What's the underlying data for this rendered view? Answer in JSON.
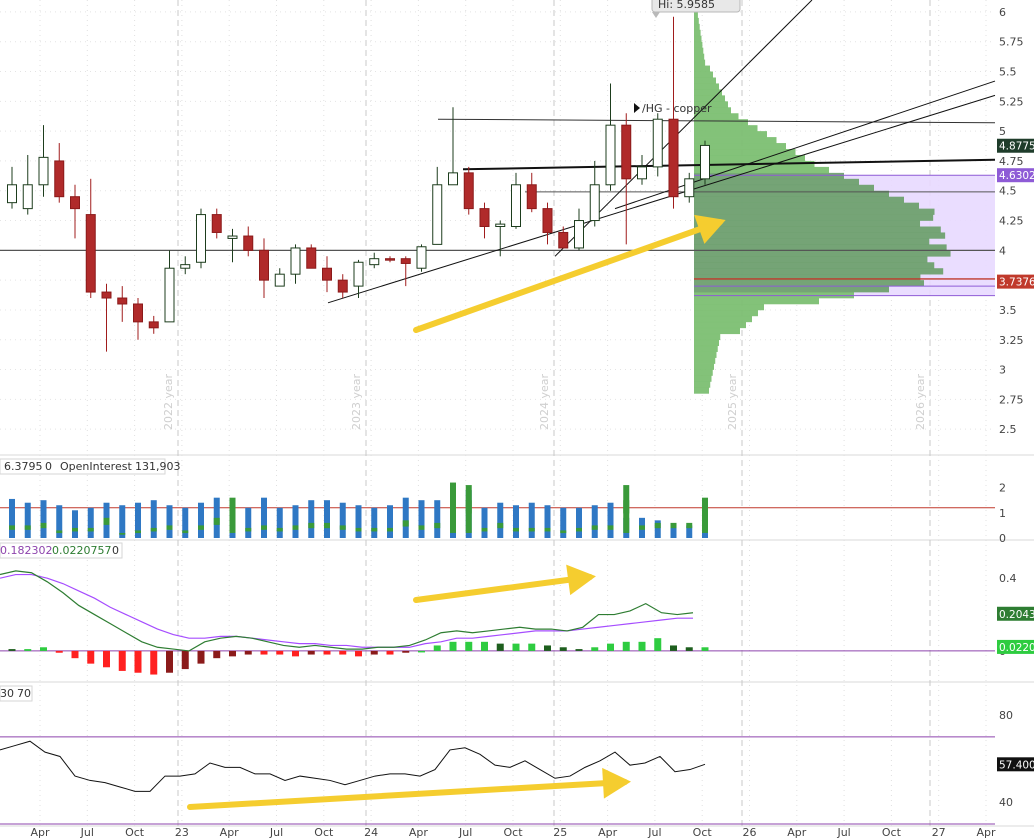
{
  "chart_data": [
    {
      "type": "candlestick",
      "name": "price",
      "annotation_symbol": "/HG - copper",
      "high_label": "Hi: 5.9585",
      "y_ticks": [
        "6",
        "5.75",
        "5.5",
        "5.25",
        "5",
        "4.75",
        "4.5",
        "4.25",
        "4",
        "3.75",
        "3.5",
        "3.25",
        "3",
        "2.75",
        "2.5"
      ],
      "ylim": [
        2.3,
        6.1
      ],
      "year_labels": [
        {
          "x": "2022-01",
          "label": "2022 year"
        },
        {
          "x": "2023-01",
          "label": "2023 year"
        },
        {
          "x": "2024-01",
          "label": "2024 year"
        },
        {
          "x": "2025-01",
          "label": "2025 year"
        },
        {
          "x": "2026-01",
          "label": "2026 year"
        }
      ],
      "price_tags": [
        {
          "value": 4.8775,
          "label": "4.8775",
          "color": "#1f3d2b"
        },
        {
          "value": 4.6302,
          "label": "4.6302",
          "color": "#8e5bd6"
        },
        {
          "value": 3.7376,
          "label": "3.7376",
          "color": "#c0392b"
        }
      ],
      "horizontal_levels": [
        4.0,
        4.9
      ],
      "candles": [
        {
          "o": 4.4,
          "h": 4.7,
          "l": 4.35,
          "c": 4.55
        },
        {
          "o": 4.35,
          "h": 4.8,
          "l": 4.3,
          "c": 4.55
        },
        {
          "o": 4.55,
          "h": 5.05,
          "l": 4.45,
          "c": 4.78
        },
        {
          "o": 4.75,
          "h": 4.9,
          "l": 4.4,
          "c": 4.45
        },
        {
          "o": 4.45,
          "h": 4.55,
          "l": 4.1,
          "c": 4.35
        },
        {
          "o": 4.3,
          "h": 4.6,
          "l": 3.6,
          "c": 3.65
        },
        {
          "o": 3.65,
          "h": 3.72,
          "l": 3.15,
          "c": 3.6
        },
        {
          "o": 3.6,
          "h": 3.7,
          "l": 3.4,
          "c": 3.55
        },
        {
          "o": 3.55,
          "h": 3.6,
          "l": 3.25,
          "c": 3.4
        },
        {
          "o": 3.4,
          "h": 3.45,
          "l": 3.3,
          "c": 3.35
        },
        {
          "o": 3.4,
          "h": 4.0,
          "l": 3.4,
          "c": 3.85
        },
        {
          "o": 3.85,
          "h": 3.95,
          "l": 3.8,
          "c": 3.88
        },
        {
          "o": 3.9,
          "h": 4.35,
          "l": 3.85,
          "c": 4.3
        },
        {
          "o": 4.3,
          "h": 4.35,
          "l": 4.1,
          "c": 4.15
        },
        {
          "o": 4.1,
          "h": 4.18,
          "l": 3.9,
          "c": 4.12
        },
        {
          "o": 4.12,
          "h": 4.2,
          "l": 3.95,
          "c": 4.0
        },
        {
          "o": 4.0,
          "h": 4.1,
          "l": 3.6,
          "c": 3.75
        },
        {
          "o": 3.7,
          "h": 3.85,
          "l": 3.7,
          "c": 3.8
        },
        {
          "o": 3.8,
          "h": 4.05,
          "l": 3.72,
          "c": 4.02
        },
        {
          "o": 4.02,
          "h": 4.05,
          "l": 3.85,
          "c": 3.85
        },
        {
          "o": 3.85,
          "h": 3.95,
          "l": 3.65,
          "c": 3.75
        },
        {
          "o": 3.75,
          "h": 3.8,
          "l": 3.6,
          "c": 3.65
        },
        {
          "o": 3.7,
          "h": 3.92,
          "l": 3.6,
          "c": 3.9
        },
        {
          "o": 3.88,
          "h": 3.98,
          "l": 3.85,
          "c": 3.93
        },
        {
          "o": 3.93,
          "h": 3.95,
          "l": 3.9,
          "c": 3.92
        },
        {
          "o": 3.93,
          "h": 3.95,
          "l": 3.7,
          "c": 3.89
        },
        {
          "o": 3.85,
          "h": 4.05,
          "l": 3.82,
          "c": 4.03
        },
        {
          "o": 4.05,
          "h": 4.7,
          "l": 4.05,
          "c": 4.55
        },
        {
          "o": 4.55,
          "h": 5.2,
          "l": 4.55,
          "c": 4.65
        },
        {
          "o": 4.65,
          "h": 4.7,
          "l": 4.3,
          "c": 4.35
        },
        {
          "o": 4.35,
          "h": 4.4,
          "l": 4.1,
          "c": 4.2
        },
        {
          "o": 4.2,
          "h": 4.25,
          "l": 3.95,
          "c": 4.22
        },
        {
          "o": 4.2,
          "h": 4.65,
          "l": 4.18,
          "c": 4.55
        },
        {
          "o": 4.55,
          "h": 4.65,
          "l": 4.32,
          "c": 4.35
        },
        {
          "o": 4.35,
          "h": 4.4,
          "l": 4.05,
          "c": 4.15
        },
        {
          "o": 4.15,
          "h": 4.2,
          "l": 4.02,
          "c": 4.02
        },
        {
          "o": 4.02,
          "h": 4.35,
          "l": 4.0,
          "c": 4.25
        },
        {
          "o": 4.25,
          "h": 4.75,
          "l": 4.2,
          "c": 4.55
        },
        {
          "o": 4.55,
          "h": 5.4,
          "l": 4.5,
          "c": 5.05
        },
        {
          "o": 5.05,
          "h": 5.15,
          "l": 4.05,
          "c": 4.6
        },
        {
          "o": 4.6,
          "h": 4.8,
          "l": 4.55,
          "c": 4.7
        },
        {
          "o": 4.7,
          "h": 5.15,
          "l": 4.62,
          "c": 5.1
        },
        {
          "o": 5.1,
          "h": 5.96,
          "l": 4.35,
          "c": 4.45
        },
        {
          "o": 4.45,
          "h": 4.65,
          "l": 4.4,
          "c": 4.6
        },
        {
          "o": 4.6,
          "h": 4.92,
          "l": 4.55,
          "c": 4.88
        }
      ]
    },
    {
      "type": "bar",
      "name": "volume",
      "header": [
        "6.3795",
        "0",
        "OpenInterest",
        "131,903"
      ],
      "y_ticks": [
        "2",
        "1",
        "0"
      ],
      "reference_level": 1.2,
      "ylim": [
        0,
        2.5
      ],
      "open_interest": [
        1.55,
        1.4,
        1.5,
        1.3,
        1.1,
        1.2,
        1.4,
        1.3,
        1.4,
        1.5,
        1.3,
        1.2,
        1.4,
        1.6,
        1.4,
        1.2,
        1.6,
        1.2,
        1.3,
        1.5,
        1.5,
        1.4,
        1.3,
        1.2,
        1.3,
        1.6,
        1.5,
        1.5,
        2.0,
        1.9,
        1.2,
        1.4,
        1.3,
        1.4,
        1.3,
        1.2,
        1.2,
        1.3,
        1.4,
        0.8,
        0.8,
        0.7,
        0.4,
        0.5,
        0.7
      ],
      "volume_extra": [
        0.5,
        0.5,
        0.6,
        0.3,
        0.4,
        0.4,
        0.8,
        0.2,
        0.3,
        0.4,
        0.5,
        0.3,
        0.5,
        0.8,
        1.0,
        0.4,
        0.5,
        0.4,
        0.5,
        0.6,
        0.6,
        0.5,
        0.4,
        0.4,
        0.4,
        0.7,
        0.5,
        0.6,
        1.6,
        1.5,
        0.4,
        0.6,
        0.4,
        0.4,
        0.4,
        0.3,
        0.4,
        0.5,
        0.5,
        1.5,
        0.5,
        0.6,
        0.6,
        0.6,
        1.0
      ]
    },
    {
      "type": "line",
      "name": "macd",
      "header": [
        "0.182302",
        "0.0220757",
        "0"
      ],
      "y_ticks": [
        "0.4",
        "0.2",
        "0"
      ],
      "ylim": [
        -0.16,
        0.5
      ],
      "price_tags": [
        {
          "value": 0.2043,
          "label": "0.2043",
          "color": "#2e7d32"
        },
        {
          "value": 0.022,
          "label": "0.0220",
          "color": "#2ecc40"
        }
      ],
      "macd": [
        0.42,
        0.44,
        0.43,
        0.38,
        0.32,
        0.25,
        0.2,
        0.15,
        0.1,
        0.05,
        0.02,
        0.01,
        0.0,
        0.05,
        0.07,
        0.08,
        0.07,
        0.05,
        0.03,
        0.02,
        0.03,
        0.02,
        0.01,
        0.01,
        0.02,
        0.02,
        0.03,
        0.06,
        0.1,
        0.11,
        0.1,
        0.11,
        0.12,
        0.13,
        0.12,
        0.12,
        0.11,
        0.13,
        0.2,
        0.2,
        0.22,
        0.26,
        0.21,
        0.2,
        0.21
      ],
      "signal": [
        0.4,
        0.42,
        0.42,
        0.4,
        0.37,
        0.33,
        0.29,
        0.24,
        0.2,
        0.16,
        0.12,
        0.09,
        0.07,
        0.07,
        0.08,
        0.08,
        0.07,
        0.06,
        0.05,
        0.04,
        0.04,
        0.03,
        0.03,
        0.02,
        0.02,
        0.02,
        0.02,
        0.04,
        0.05,
        0.07,
        0.07,
        0.08,
        0.09,
        0.1,
        0.11,
        0.11,
        0.11,
        0.12,
        0.13,
        0.14,
        0.15,
        0.16,
        0.17,
        0.18,
        0.18
      ],
      "histogram": [
        0.01,
        0.01,
        0.02,
        -0.01,
        -0.04,
        -0.07,
        -0.09,
        -0.11,
        -0.12,
        -0.13,
        -0.12,
        -0.1,
        -0.07,
        -0.04,
        -0.03,
        -0.02,
        -0.02,
        -0.02,
        -0.03,
        -0.02,
        -0.02,
        -0.02,
        -0.03,
        -0.02,
        -0.02,
        -0.01,
        0.0,
        0.03,
        0.05,
        0.05,
        0.05,
        0.04,
        0.04,
        0.04,
        0.03,
        0.02,
        0.01,
        0.02,
        0.04,
        0.05,
        0.05,
        0.07,
        0.03,
        0.02,
        0.02
      ]
    },
    {
      "type": "line",
      "name": "rsi",
      "header": [
        "30",
        "70"
      ],
      "y_ticks": [
        "80",
        "40"
      ],
      "ylim": [
        30,
        86
      ],
      "levels": [
        70,
        30
      ],
      "price_tags": [
        {
          "value": 57.4,
          "label": "57.400",
          "color": "#111111"
        }
      ],
      "values": [
        64,
        66,
        68,
        63,
        61,
        52,
        50,
        49,
        47,
        45,
        45,
        52,
        52,
        53,
        58,
        56,
        56,
        53,
        53,
        50,
        52,
        51,
        50,
        48,
        50,
        52,
        53,
        53,
        52,
        55,
        64,
        65,
        62,
        57,
        56,
        59,
        55,
        51,
        52,
        56,
        59,
        63,
        57,
        58,
        61,
        54,
        55,
        57.4
      ],
      "x_tick_labels": [
        "Apr",
        "Jul",
        "Oct",
        "23",
        "Apr",
        "Jul",
        "Oct",
        "24",
        "Apr",
        "Jul",
        "Oct",
        "25",
        "Apr",
        "Jul",
        "Oct",
        "26",
        "Apr",
        "Jul",
        "Oct",
        "27",
        "Apr"
      ]
    }
  ]
}
